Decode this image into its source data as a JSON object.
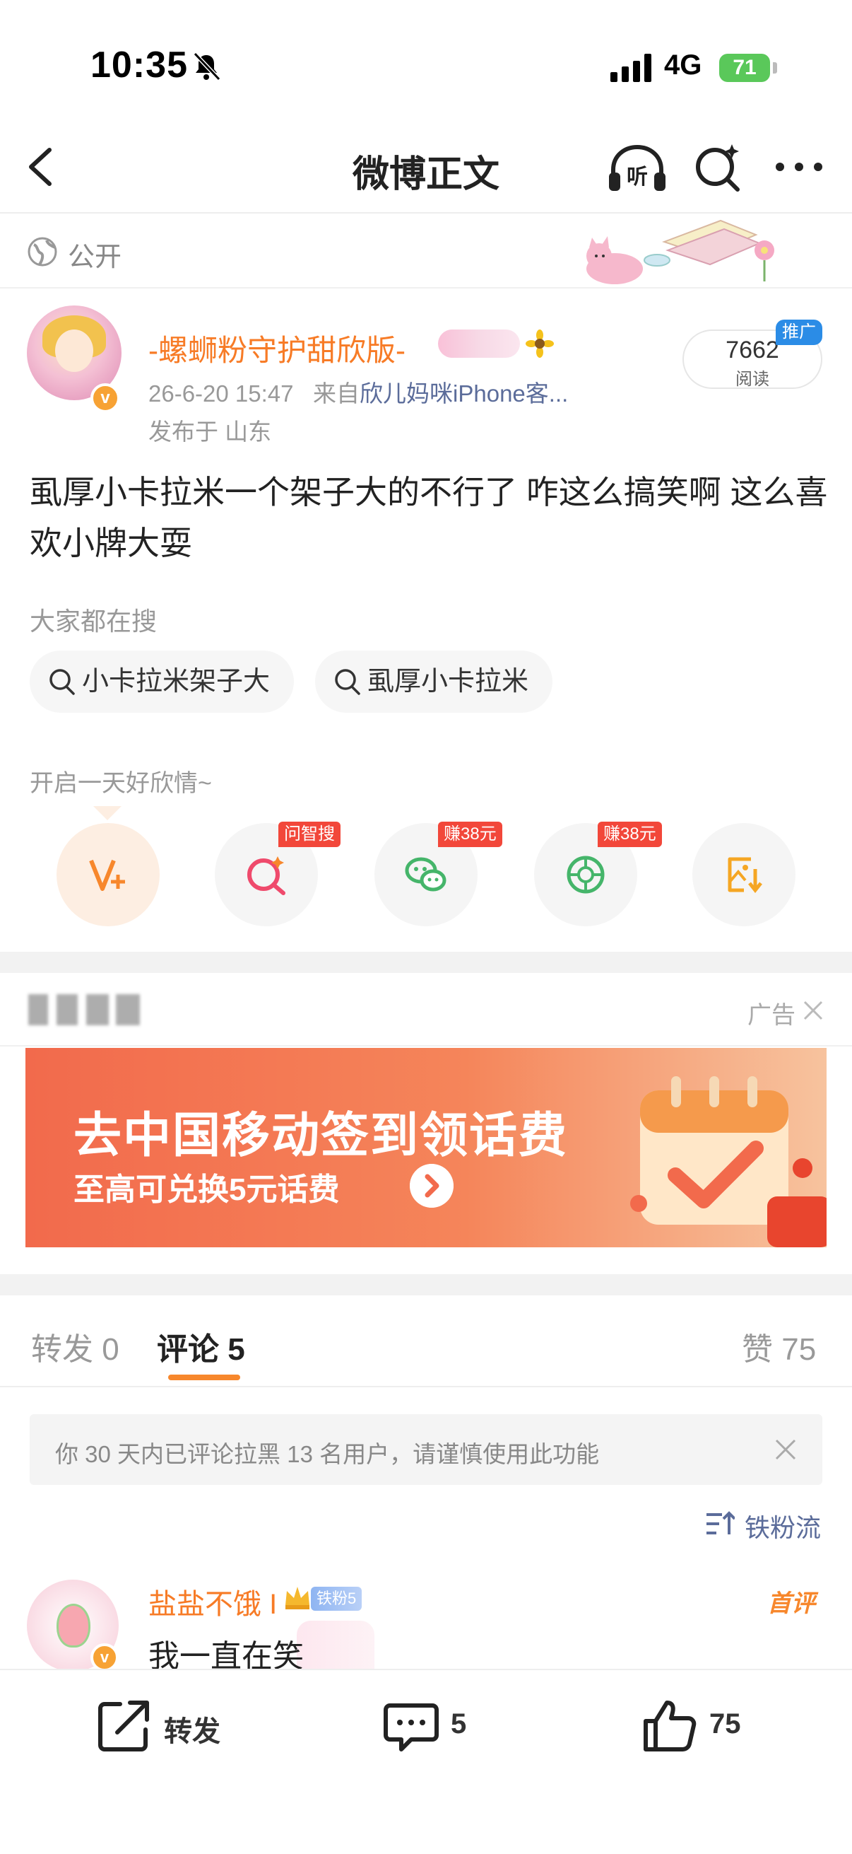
{
  "status_bar": {
    "time": "10:35",
    "network": "4G",
    "battery": "71"
  },
  "nav": {
    "title": "微博正文",
    "listen_icon_text": "听"
  },
  "visibility": {
    "label": "公开"
  },
  "post": {
    "author": "-螺蛳粉守护甜欣版-",
    "timestamp": "26-6-20 15:47",
    "source_prefix": "来自",
    "source": "欣儿妈咪iPhone客...",
    "location": "发布于 山东",
    "read_count": "7662",
    "read_label": "阅读",
    "promo_tag": "推广",
    "verified_mark": "v",
    "body": "虱厚小卡拉米一个架子大的不行了 咋这么搞笑啊 这么喜欢小牌大耍"
  },
  "hot_search": {
    "title": "大家都在搜",
    "chips": [
      "小卡拉米架子大",
      "虱厚小卡拉米"
    ]
  },
  "tools": {
    "greeting": "开启一天好欣情~",
    "badges": [
      "问智搜",
      "赚38元",
      "赚38元"
    ]
  },
  "ad": {
    "label": "广告",
    "title": "去中国移动签到领话费",
    "subtitle": "至高可兑换5元话费"
  },
  "tabs": {
    "repost": "转发 0",
    "comment": "评论 5",
    "like": "赞 75"
  },
  "notice": {
    "text": "你 30 天内已评论拉黑 13 名用户，请谨慎使用此功能"
  },
  "sort": {
    "label": "铁粉流"
  },
  "comment": {
    "user": "盐盐不饿 I",
    "badge": "铁粉5",
    "first_tag": "首评",
    "text": "我一直在笑"
  },
  "bottom_bar": {
    "repost_label": "转发",
    "comment_count": "5",
    "like_count": "75"
  },
  "colors": {
    "accent": "#f77b26",
    "link": "#5b6c9a",
    "badge_red": "#f2473a",
    "promo_blue": "#2b8ce6"
  },
  "icons": [
    "bell-slash-icon",
    "signal-icon",
    "back-arrow-icon",
    "listen-icon",
    "search-icon",
    "more-icon",
    "globe-icon",
    "sunflower-icon",
    "vplus-icon",
    "smart-search-icon",
    "wechat-icon",
    "moments-icon",
    "save-image-icon",
    "close-icon",
    "sort-icon",
    "crown-icon",
    "share-icon",
    "comment-icon",
    "like-icon"
  ]
}
